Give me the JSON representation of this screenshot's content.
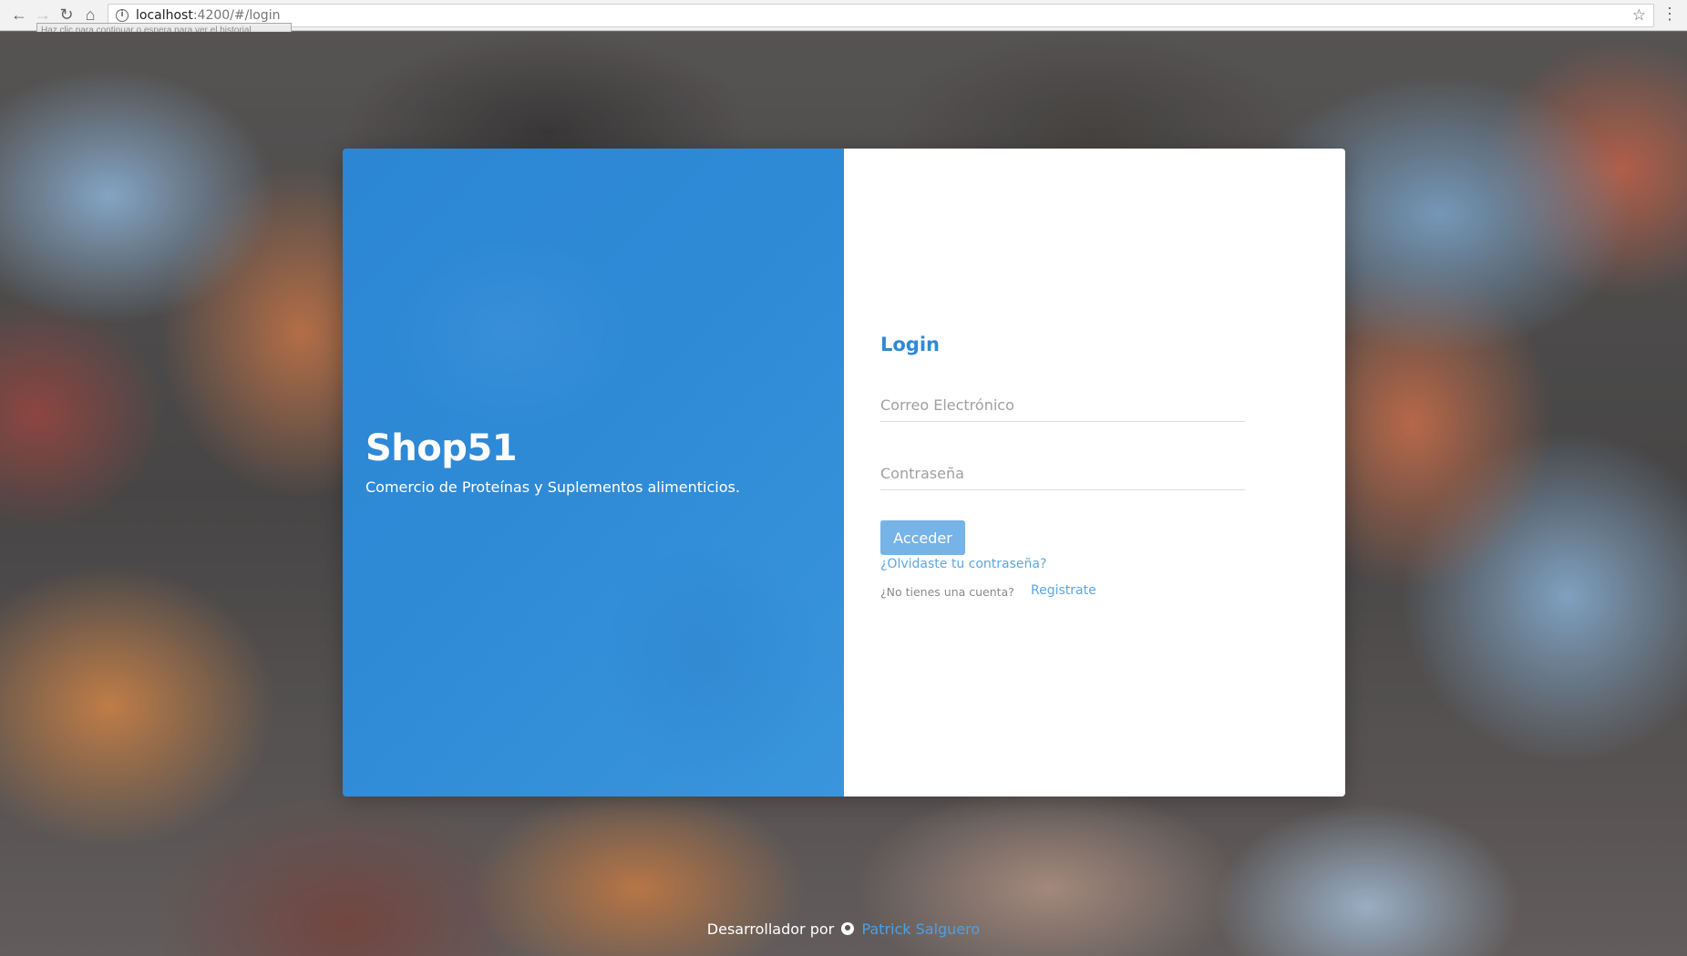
{
  "browser": {
    "url_host": "localhost",
    "url_rest": ":4200/#/login",
    "tooltip": "Haz clic para continuar o espera para ver el historial",
    "icons": [
      "back-arrow-icon",
      "forward-arrow-icon",
      "reload-icon",
      "home-icon",
      "info-icon",
      "star-icon",
      "menu-icon"
    ]
  },
  "brand": {
    "name": "Shop51",
    "tagline": "Comercio de Proteínas y Suplementos alimenticios."
  },
  "login": {
    "title": "Login",
    "email_placeholder": "Correo Electrónico",
    "password_placeholder": "Contraseña",
    "submit_label": "Acceder",
    "forgot_label": "¿Olvidaste tu contraseña?",
    "no_account_label": "¿No tienes una cuenta?",
    "register_label": "Registrate"
  },
  "footer": {
    "prefix": "Desarrollador por",
    "author": "Patrick Salguero"
  },
  "colors": {
    "primary": "#2f8ad6",
    "button": "#76b3e6",
    "link": "#5ea6e2"
  }
}
